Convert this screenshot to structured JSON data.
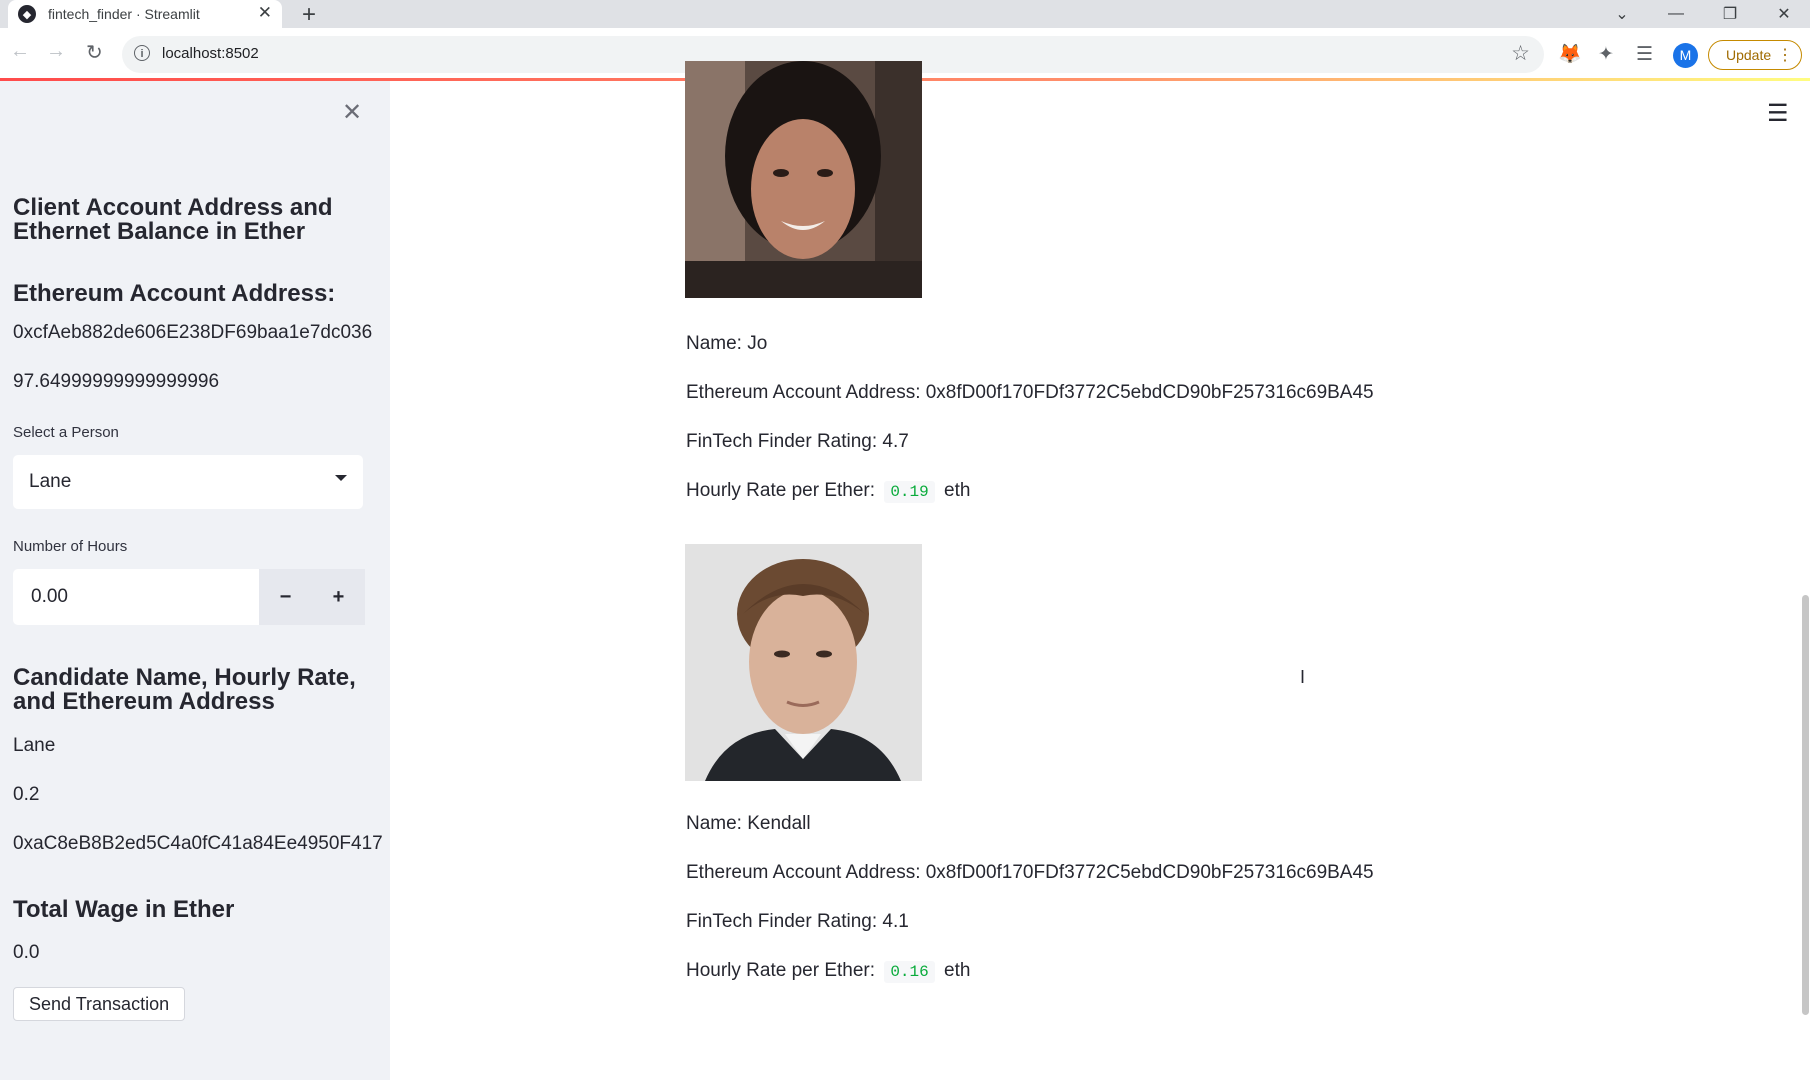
{
  "browser": {
    "tab_title": "fintech_finder · Streamlit",
    "url": "localhost:8502",
    "profile_initial": "M",
    "update_label": "Update"
  },
  "sidebar": {
    "title": "Client Account Address and Ethernet Balance in Ether",
    "account_heading": "Ethereum Account Address:",
    "account_address": "0xcfAeb882de606E238DF69baa1e7dc036",
    "balance": "97.64999999999999996",
    "select_label": "Select a Person",
    "select_value": "Lane",
    "hours_label": "Number of Hours",
    "hours_value": "0.00",
    "minus_label": "−",
    "plus_label": "+",
    "candidate_heading": "Candidate Name, Hourly Rate, and Ethereum Address",
    "candidate_name": "Lane",
    "candidate_rate": "0.2",
    "candidate_address": "0xaC8eB8B2ed5C4a0fC41a84Ee4950F417",
    "wage_heading": "Total Wage in Ether",
    "wage_value": "0.0",
    "send_label": "Send Transaction"
  },
  "main": {
    "people": [
      {
        "name_line": "Name: Jo",
        "address_line": "Ethereum Account Address: 0x8fD00f170FDf3772C5ebdCD90bF257316c69BA45",
        "rating_line": "FinTech Finder Rating: 4.7",
        "rate_prefix": "Hourly Rate per Ether:",
        "rate_value": "0.19",
        "rate_unit": "eth"
      },
      {
        "name_line": "Name: Kendall",
        "address_line": "Ethereum Account Address: 0x8fD00f170FDf3772C5ebdCD90bF257316c69BA45",
        "rating_line": "FinTech Finder Rating: 4.1",
        "rate_prefix": "Hourly Rate per Ether:",
        "rate_value": "0.16",
        "rate_unit": "eth"
      }
    ]
  },
  "colors": {
    "sidebar_bg": "#f0f2f6",
    "code_green": "#09ab3b",
    "update_border": "#c58a00",
    "profile_blue": "#1a73e8"
  }
}
